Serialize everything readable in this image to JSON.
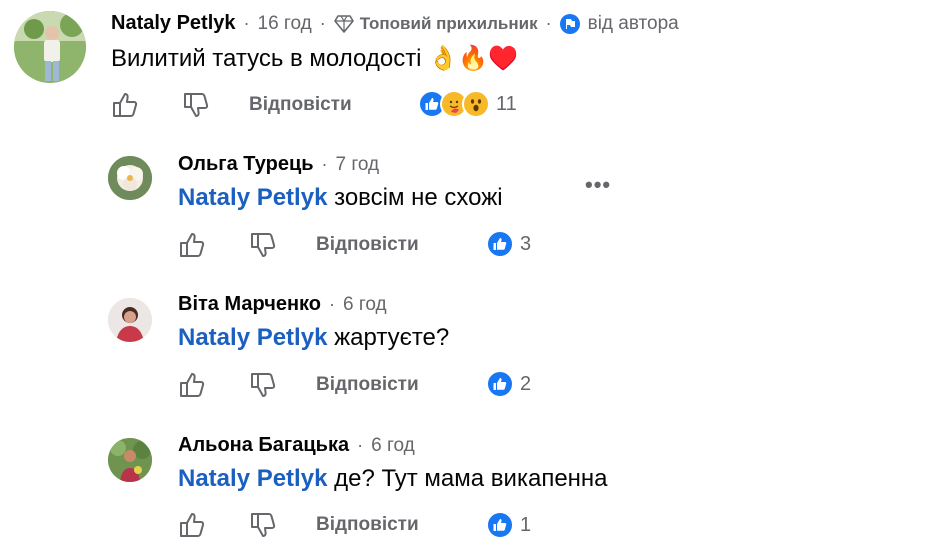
{
  "comments": [
    {
      "author": "Nataly Petlyk",
      "time": "16 год",
      "badge": "Топовий прихильник",
      "author_flag": "від автора",
      "text": "Вилитий татусь в молодості",
      "emojis": "👌🔥♥️",
      "reply_label": "Відповісти",
      "reaction_count": "11",
      "reactions": [
        "like",
        "hug",
        "wow"
      ]
    },
    {
      "author": "Ольга Турець",
      "time": "7 год",
      "mention": "Nataly Petlyk",
      "text": "зовсім не схожі",
      "reply_label": "Відповісти",
      "reaction_count": "3",
      "reactions": [
        "like"
      ]
    },
    {
      "author": "Віта Марченко",
      "time": "6 год",
      "mention": "Nataly Petlyk",
      "text": "жартуєте?",
      "reply_label": "Відповісти",
      "reaction_count": "2",
      "reactions": [
        "like"
      ]
    },
    {
      "author": "Альона Багацька",
      "time": "6 год",
      "mention": "Nataly Petlyk",
      "text": "де? Тут мама викапенна",
      "reply_label": "Відповісти",
      "reaction_count": "1",
      "reactions": [
        "like"
      ]
    }
  ],
  "icons": {
    "like": "thumb-up-icon",
    "dislike": "thumb-down-icon",
    "more": "more-options-icon",
    "badge": "diamond-icon"
  },
  "colors": {
    "mention": "#1b5fc1",
    "like_blue": "#1877f2",
    "secondary_text": "#65676b"
  }
}
